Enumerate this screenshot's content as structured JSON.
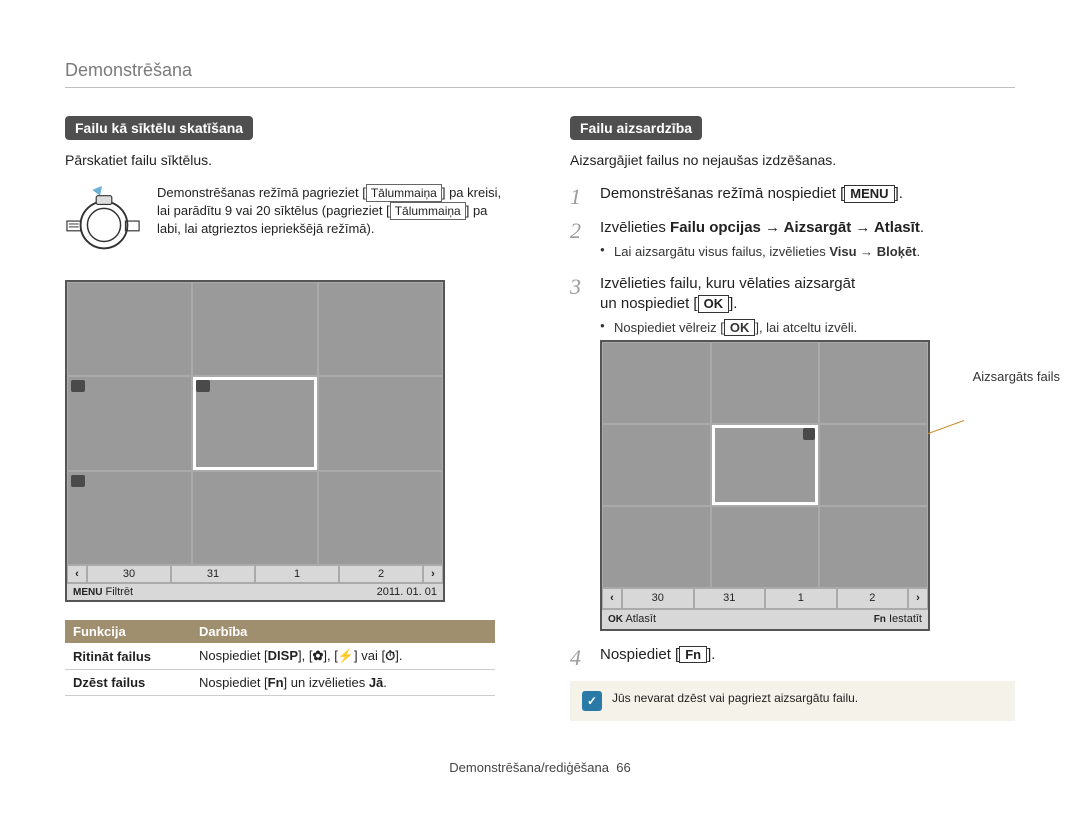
{
  "header": {
    "title": "Demonstrēšana"
  },
  "left": {
    "section_title": "Failu kā sīktēlu skatīšana",
    "section_sub": "Pārskatiet failu sīktēlus.",
    "dial_text_a": "Demonstrēšanas režīmā pagrieziet [",
    "dial_text_b": "] pa kreisi, lai parādītu 9 vai 20 sīktēlus (pagrieziet [",
    "dial_text_c": "] pa labi, lai atgrieztos iepriekšējā režīmā).",
    "zoom_label": "Tālummaiņa",
    "grid": {
      "tabs": [
        "30",
        "31",
        "1",
        "2"
      ],
      "footer_menu_label": "MENU",
      "footer_filter": "Filtrēt",
      "footer_date": "2011. 01. 01"
    },
    "table": {
      "head_func": "Funkcija",
      "head_action": "Darbība",
      "row1_label": "Ritināt failus",
      "row1_prefix": "Nospiediet [",
      "row1_b1": "DISP",
      "row1_mid1": "], [",
      "row1_b2": "✿",
      "row1_mid2": "], [",
      "row1_b3": "⚡",
      "row1_mid3": "] vai [",
      "row1_b4": "⏱",
      "row1_suffix": "].",
      "row2_label": "Dzēst failus",
      "row2_prefix": "Nospiediet [",
      "row2_btn": "Fn",
      "row2_mid": "] un izvēlieties ",
      "row2_bold": "Jā",
      "row2_suffix": "."
    }
  },
  "right": {
    "section_title": "Failu aizsardzība",
    "section_sub": "Aizsargājiet failus no nejaušas izdzēšanas.",
    "step1_a": "Demonstrēšanas režīmā nospiediet [",
    "step1_btn": "MENU",
    "step1_b": "].",
    "step2_a": "Izvēlieties ",
    "step2_bold": "Failu opcijas → Aizsargāt → Atlasīt",
    "step2_b": ".",
    "step2_sub_a": "Lai aizsargātu visus failus, izvēlieties ",
    "step2_sub_bold": "Visu → Bloķēt",
    "step2_sub_b": ".",
    "step3_line1": "Izvēlieties failu, kuru vēlaties aizsargāt",
    "step3_line2a": "un nospiediet [",
    "step3_btn": "OK",
    "step3_line2b": "].",
    "step3_sub_a": "Nospiediet vēlreiz [",
    "step3_sub_btn": "OK",
    "step3_sub_b": "], lai atceltu izvēli.",
    "callout_label": "Aizsargāts fails",
    "grid2": {
      "tabs": [
        "30",
        "31",
        "1",
        "2"
      ],
      "footer_ok_label": "OK",
      "footer_ok_text": "Atlasīt",
      "footer_fn_label": "Fn",
      "footer_fn_text": "Iestatīt"
    },
    "step4_a": "Nospiediet [",
    "step4_btn": "Fn",
    "step4_b": "].",
    "note": "Jūs nevarat dzēst vai pagriezt aizsargātu failu."
  },
  "footer": {
    "section": "Demonstrēšana/rediģēšana",
    "page": "66"
  }
}
